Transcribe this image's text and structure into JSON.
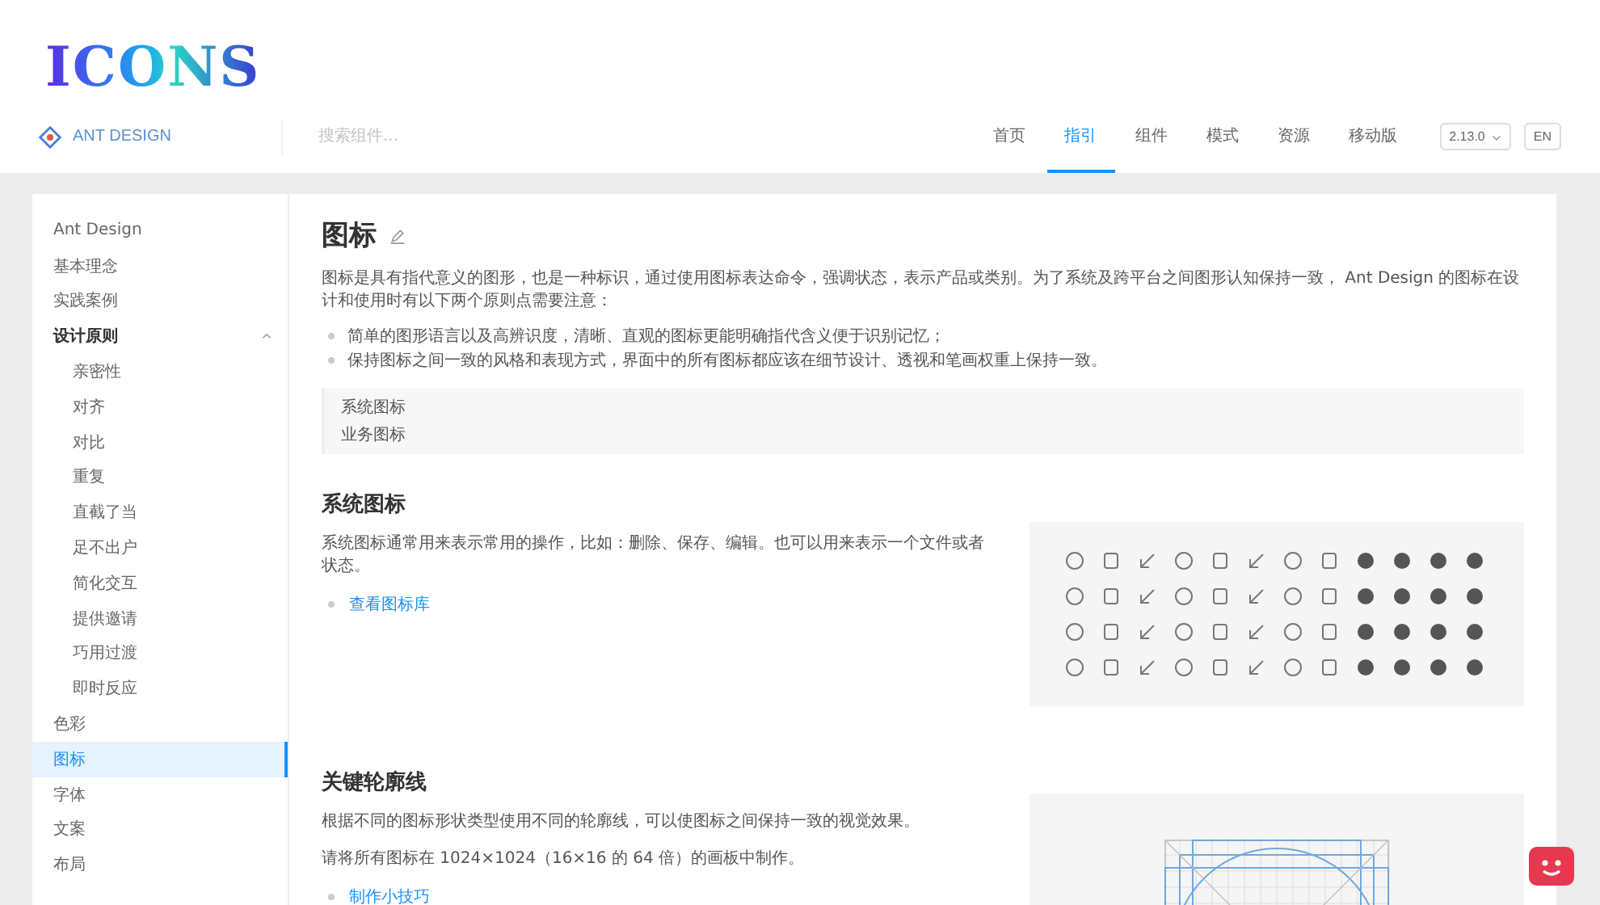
{
  "logo": {
    "text": "ICONS"
  },
  "header": {
    "brand": "ANT DESIGN",
    "search": {
      "placeholder": "搜索组件..."
    },
    "nav": [
      {
        "label": "首页",
        "selected": false
      },
      {
        "label": "指引",
        "selected": true
      },
      {
        "label": "组件",
        "selected": false
      },
      {
        "label": "模式",
        "selected": false
      },
      {
        "label": "资源",
        "selected": false
      },
      {
        "label": "移动版",
        "selected": false
      }
    ],
    "version": "2.13.0",
    "language": "EN"
  },
  "sidebar": {
    "items": [
      {
        "label": "Ant Design",
        "selected": false
      },
      {
        "label": "基本理念",
        "selected": false
      },
      {
        "label": "实践案例",
        "selected": false
      },
      {
        "label": "设计原则",
        "expanded": true,
        "children": [
          {
            "label": "亲密性",
            "selected": false
          },
          {
            "label": "对齐",
            "selected": false
          },
          {
            "label": "对比",
            "selected": false
          },
          {
            "label": "重复",
            "selected": false
          },
          {
            "label": "直截了当",
            "selected": false
          },
          {
            "label": "足不出户",
            "selected": false
          },
          {
            "label": "简化交互",
            "selected": false
          },
          {
            "label": "提供邀请",
            "selected": false
          },
          {
            "label": "巧用过渡",
            "selected": false
          },
          {
            "label": "即时反应",
            "selected": false
          }
        ]
      },
      {
        "label": "色彩",
        "selected": false
      },
      {
        "label": "图标",
        "selected": true
      },
      {
        "label": "字体",
        "selected": false
      },
      {
        "label": "文案",
        "selected": false
      },
      {
        "label": "布局",
        "selected": false
      }
    ]
  },
  "article": {
    "title": "图标",
    "intro": "图标是具有指代意义的图形，也是一种标识，通过使用图标表达命令，强调状态，表示产品或类别。为了系统及跨平台之间图形认知保持一致， Ant Design 的图标在设计和使用时有以下两个原则点需要注意：",
    "principles": [
      "简单的图形语言以及高辨识度，清晰、直观的图标更能明确指代含义便于识别记忆；",
      "保持图标之间一致的风格和表现方式，界面中的所有图标都应该在细节设计、透视和笔画权重上保持一致。"
    ],
    "toc": [
      "系统图标",
      "业务图标"
    ],
    "sections": [
      {
        "heading": "系统图标",
        "paragraphs": [
          "系统图标通常用来表示常用的操作，比如：删除、保存、编辑。也可以用来表示一个文件或者状态。"
        ],
        "links": [
          "查看图标库"
        ],
        "figure": {
          "kind": "icon-grid"
        }
      },
      {
        "heading": "关键轮廓线",
        "paragraphs": [
          "根据不同的图标形状类型使用不同的轮廓线，可以使图标之间保持一致的视觉效果。",
          "请将所有图标在 1024×1024（16×16 的 64 倍）的画板中制作。"
        ],
        "links": [
          "制作小技巧"
        ],
        "figure": {
          "kind": "keyline"
        }
      }
    ]
  }
}
